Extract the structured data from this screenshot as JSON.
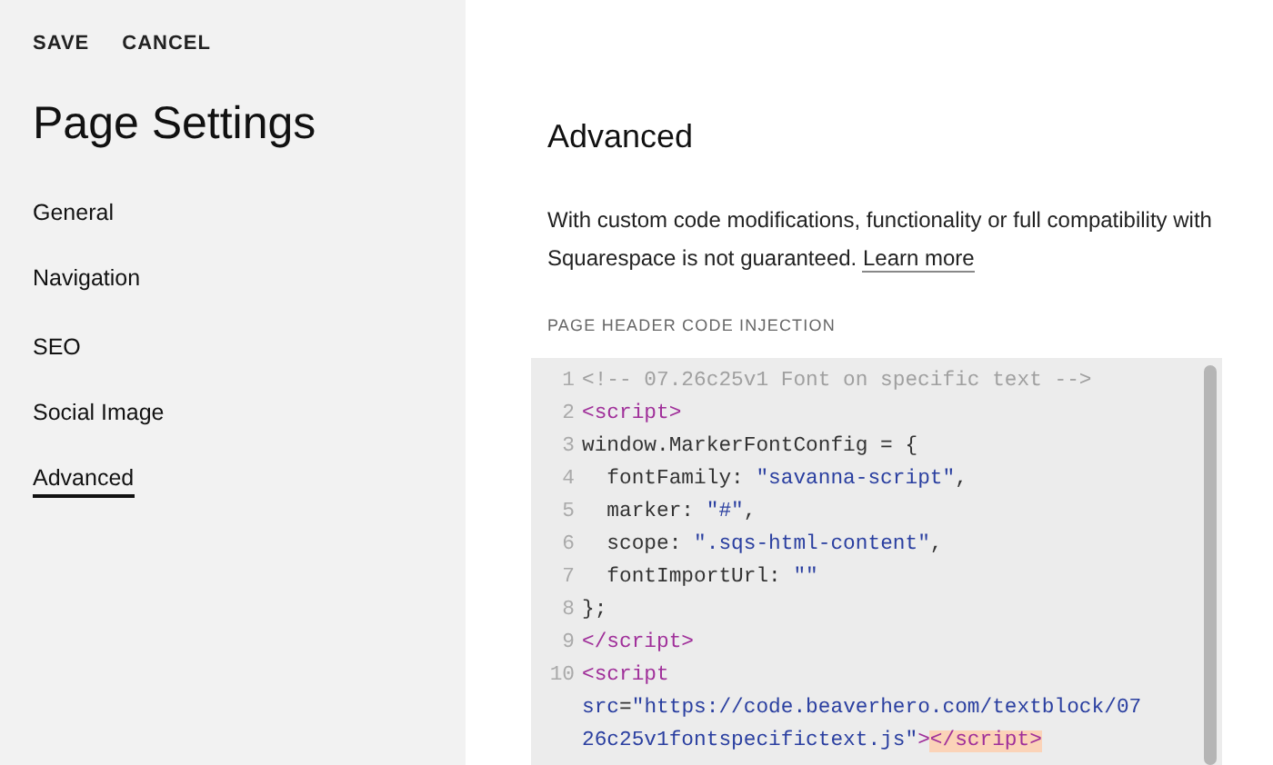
{
  "header_actions": [
    "SAVE",
    "CANCEL"
  ],
  "sidebar": {
    "title": "Page Settings",
    "groups": [
      [
        {
          "label": "General",
          "selected": false
        },
        {
          "label": "Navigation",
          "selected": false
        }
      ],
      [
        {
          "label": "SEO",
          "selected": false
        },
        {
          "label": "Social Image",
          "selected": false
        },
        {
          "label": "Advanced",
          "selected": true
        }
      ]
    ]
  },
  "panel": {
    "title": "Advanced",
    "description": "With custom code modifications, functionality or full compatibility with Squarespace is not guaranteed.",
    "link": "Learn more",
    "field_label": "PAGE HEADER CODE INJECTION",
    "code_lines": [
      {
        "number": "1",
        "tokens": [
          {
            "kind": "comment",
            "text": "<!-- 07.26c25v1 Font on specific text -->"
          }
        ]
      },
      {
        "number": "2",
        "tokens": [
          {
            "kind": "tag",
            "text": "<script>"
          }
        ]
      },
      {
        "number": "3",
        "tokens": [
          {
            "kind": "plain",
            "text": "window.MarkerFontConfig = {"
          }
        ]
      },
      {
        "number": "4",
        "tokens": [
          {
            "kind": "plain",
            "text": "  fontFamily: "
          },
          {
            "kind": "string",
            "text": "\"savanna-script\""
          },
          {
            "kind": "plain",
            "text": ","
          }
        ]
      },
      {
        "number": "5",
        "tokens": [
          {
            "kind": "plain",
            "text": "  marker: "
          },
          {
            "kind": "string",
            "text": "\"#\""
          },
          {
            "kind": "plain",
            "text": ","
          }
        ]
      },
      {
        "number": "6",
        "tokens": [
          {
            "kind": "plain",
            "text": "  scope: "
          },
          {
            "kind": "string",
            "text": "\".sqs-html-content\""
          },
          {
            "kind": "plain",
            "text": ","
          }
        ]
      },
      {
        "number": "7",
        "tokens": [
          {
            "kind": "plain",
            "text": "  fontImportUrl: "
          },
          {
            "kind": "string",
            "text": "\"\""
          }
        ]
      },
      {
        "number": "8",
        "tokens": [
          {
            "kind": "plain",
            "text": "};"
          }
        ]
      },
      {
        "number": "9",
        "tokens": [
          {
            "kind": "tag",
            "text": "</script>"
          }
        ]
      },
      {
        "number": "10",
        "tokens": [
          {
            "kind": "tag",
            "text": "<script "
          },
          {
            "kind": "attr",
            "text": "src"
          },
          {
            "kind": "plain",
            "text": "="
          },
          {
            "kind": "string",
            "text": "\"https://code.beaverhero.com/textblock/0726c25v1fontspecifictext.js\""
          },
          {
            "kind": "tag",
            "text": ">"
          },
          {
            "kind": "tag_match",
            "text": "</script>"
          }
        ]
      }
    ]
  }
}
